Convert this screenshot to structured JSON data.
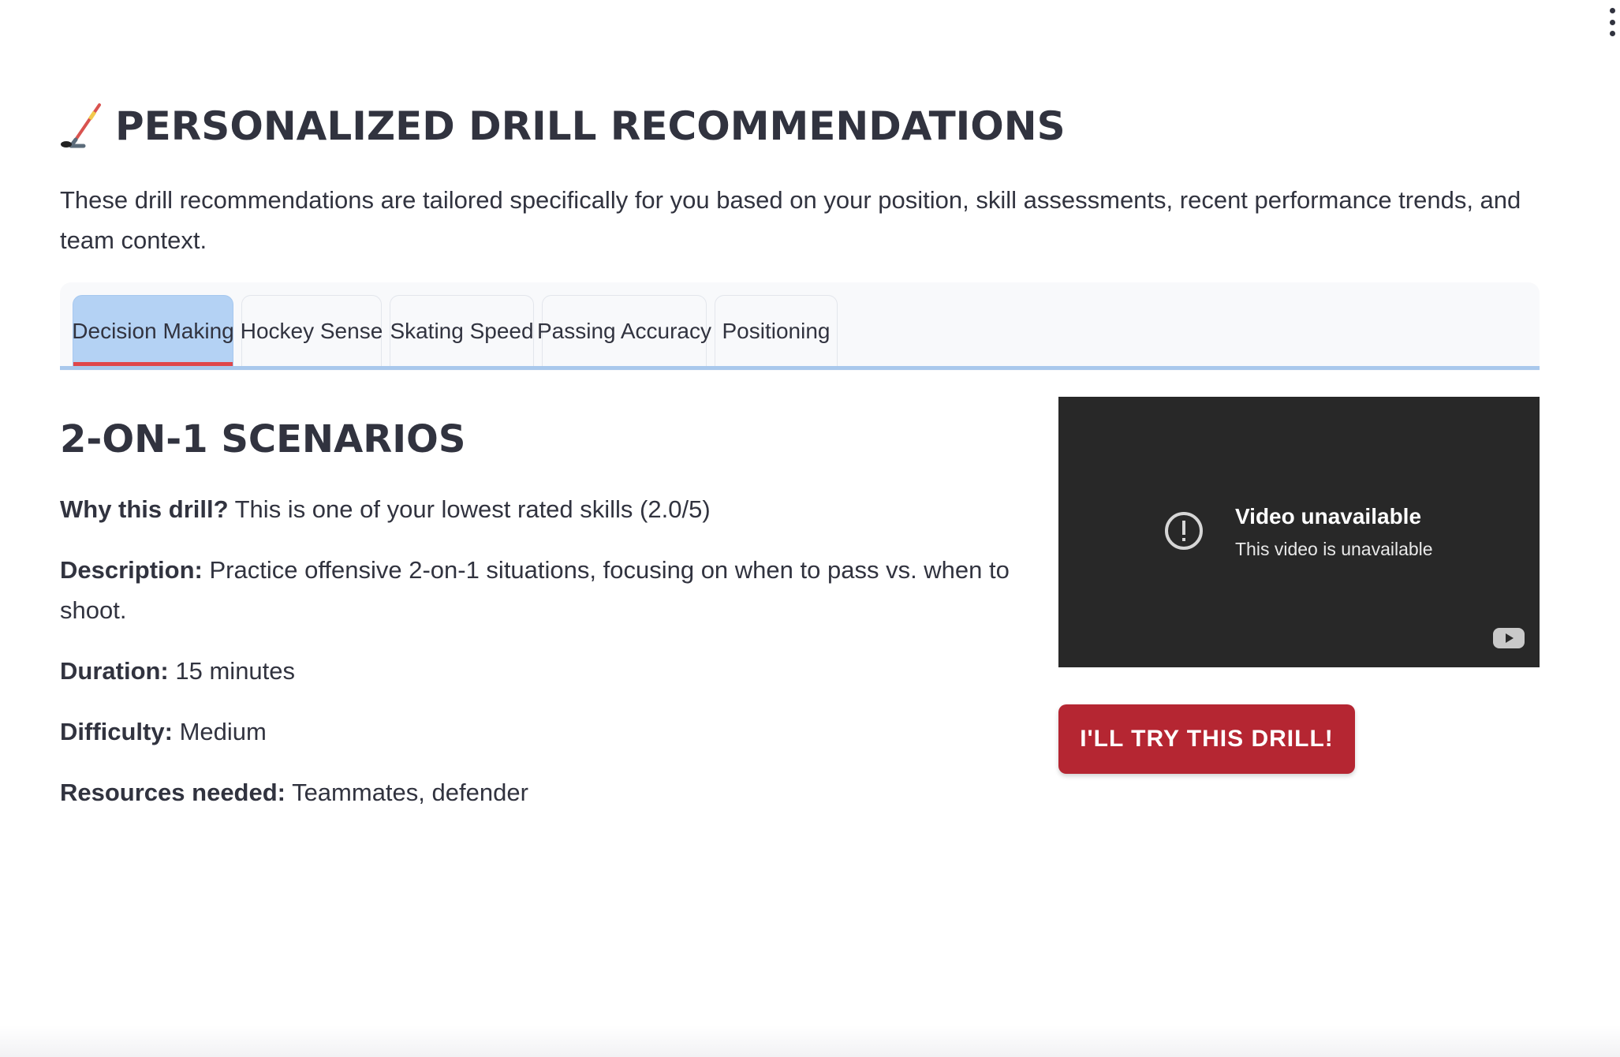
{
  "page": {
    "title": "PERSONALIZED DRILL RECOMMENDATIONS",
    "intro": "These drill recommendations are tailored specifically for you based on your position, skill assessments, recent performance trends, and team context.",
    "title_icon": "hockey-stick-icon"
  },
  "tabs": [
    {
      "label": "Decision Making",
      "active": true
    },
    {
      "label": "Hockey Sense",
      "active": false
    },
    {
      "label": "Skating Speed",
      "active": false
    },
    {
      "label": "Passing Accuracy",
      "active": false
    },
    {
      "label": "Positioning",
      "active": false
    }
  ],
  "drill": {
    "title": "2-ON-1 SCENARIOS",
    "why_label": "Why this drill?",
    "why_value": "This is one of your lowest rated skills (2.0/5)",
    "description_label": "Description:",
    "description_value": "Practice offensive 2-on-1 situations, focusing on when to pass vs. when to shoot.",
    "duration_label": "Duration:",
    "duration_value": "15 minutes",
    "difficulty_label": "Difficulty:",
    "difficulty_value": "Medium",
    "resources_label": "Resources needed:",
    "resources_value": "Teammates, defender"
  },
  "video": {
    "title": "Video unavailable",
    "subtitle": "This video is unavailable",
    "status_icon": "alert-circle-icon",
    "brand_icon": "youtube-icon"
  },
  "actions": {
    "try_label": "I'LL TRY THIS DRILL!"
  },
  "colors": {
    "accent": "#b52632",
    "active_tab": "#b4d2f4",
    "tab_underline": "#e0464a",
    "video_bg": "#282828"
  }
}
